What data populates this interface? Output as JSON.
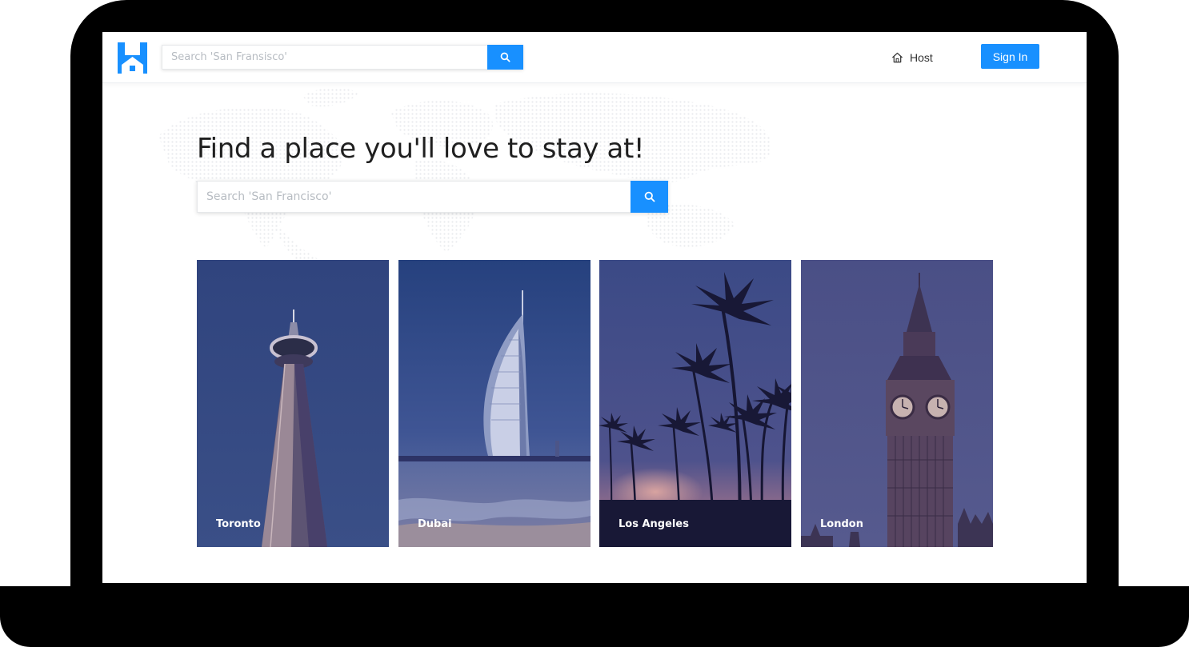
{
  "header": {
    "search_placeholder": "Search 'San Fransisco'",
    "host_label": "Host",
    "signin_label": "Sign In"
  },
  "hero": {
    "title": "Find a place you'll love to stay at!",
    "search_placeholder": "Search 'San Francisco'"
  },
  "cities": [
    {
      "name": "Toronto"
    },
    {
      "name": "Dubai"
    },
    {
      "name": "Los Angeles"
    },
    {
      "name": "London"
    }
  ],
  "colors": {
    "primary": "#1890ff",
    "overlay": "#2c3c7c"
  }
}
